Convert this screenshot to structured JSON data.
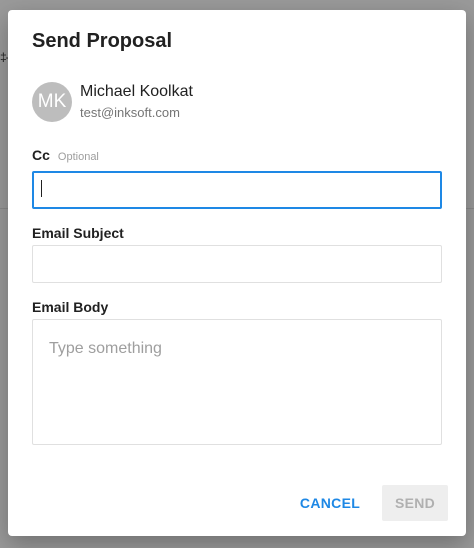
{
  "backdrop": {
    "glyph": "‡‐"
  },
  "dialog": {
    "title": "Send Proposal",
    "recipient": {
      "initials": "MK",
      "name": "Michael Koolkat",
      "email": "test@inksoft.com"
    },
    "cc": {
      "label": "Cc",
      "optional_label": "Optional",
      "value": ""
    },
    "subject": {
      "label": "Email Subject",
      "value": ""
    },
    "body": {
      "label": "Email Body",
      "placeholder": "Type something",
      "value": ""
    },
    "actions": {
      "cancel_label": "CANCEL",
      "send_label": "SEND"
    }
  },
  "colors": {
    "accent": "#1e88e5",
    "avatar_bg": "#bdbdbd",
    "disabled_bg": "#eeeeee",
    "disabled_text": "#b0b0b0"
  }
}
